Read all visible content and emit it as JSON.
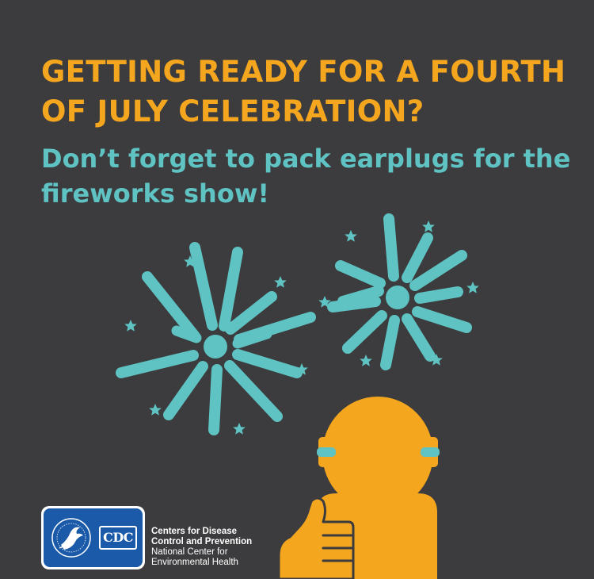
{
  "headline": "GETTING READY FOR A FOURTH OF JULY CELEBRATION?",
  "subhead": "Don’t forget to pack earplugs for the fireworks show!",
  "logo": {
    "badge_text": "CDC",
    "seal_text": "DEPARTMENT OF HEALTH & HUMAN SERVICES USA"
  },
  "organization": {
    "line1": "Centers for Disease",
    "line2": "Control and Prevention",
    "line3": "National Center for",
    "line4": "Environmental Health"
  },
  "colors": {
    "background": "#3c3c3e",
    "orange": "#f5a61f",
    "teal": "#5ec3c2",
    "cdc_blue": "#1a5aa8"
  },
  "icons": [
    "firework-left-icon",
    "firework-right-icon",
    "person-with-earplugs-icon",
    "thumbs-up-icon",
    "hhs-eagle-seal-icon"
  ]
}
